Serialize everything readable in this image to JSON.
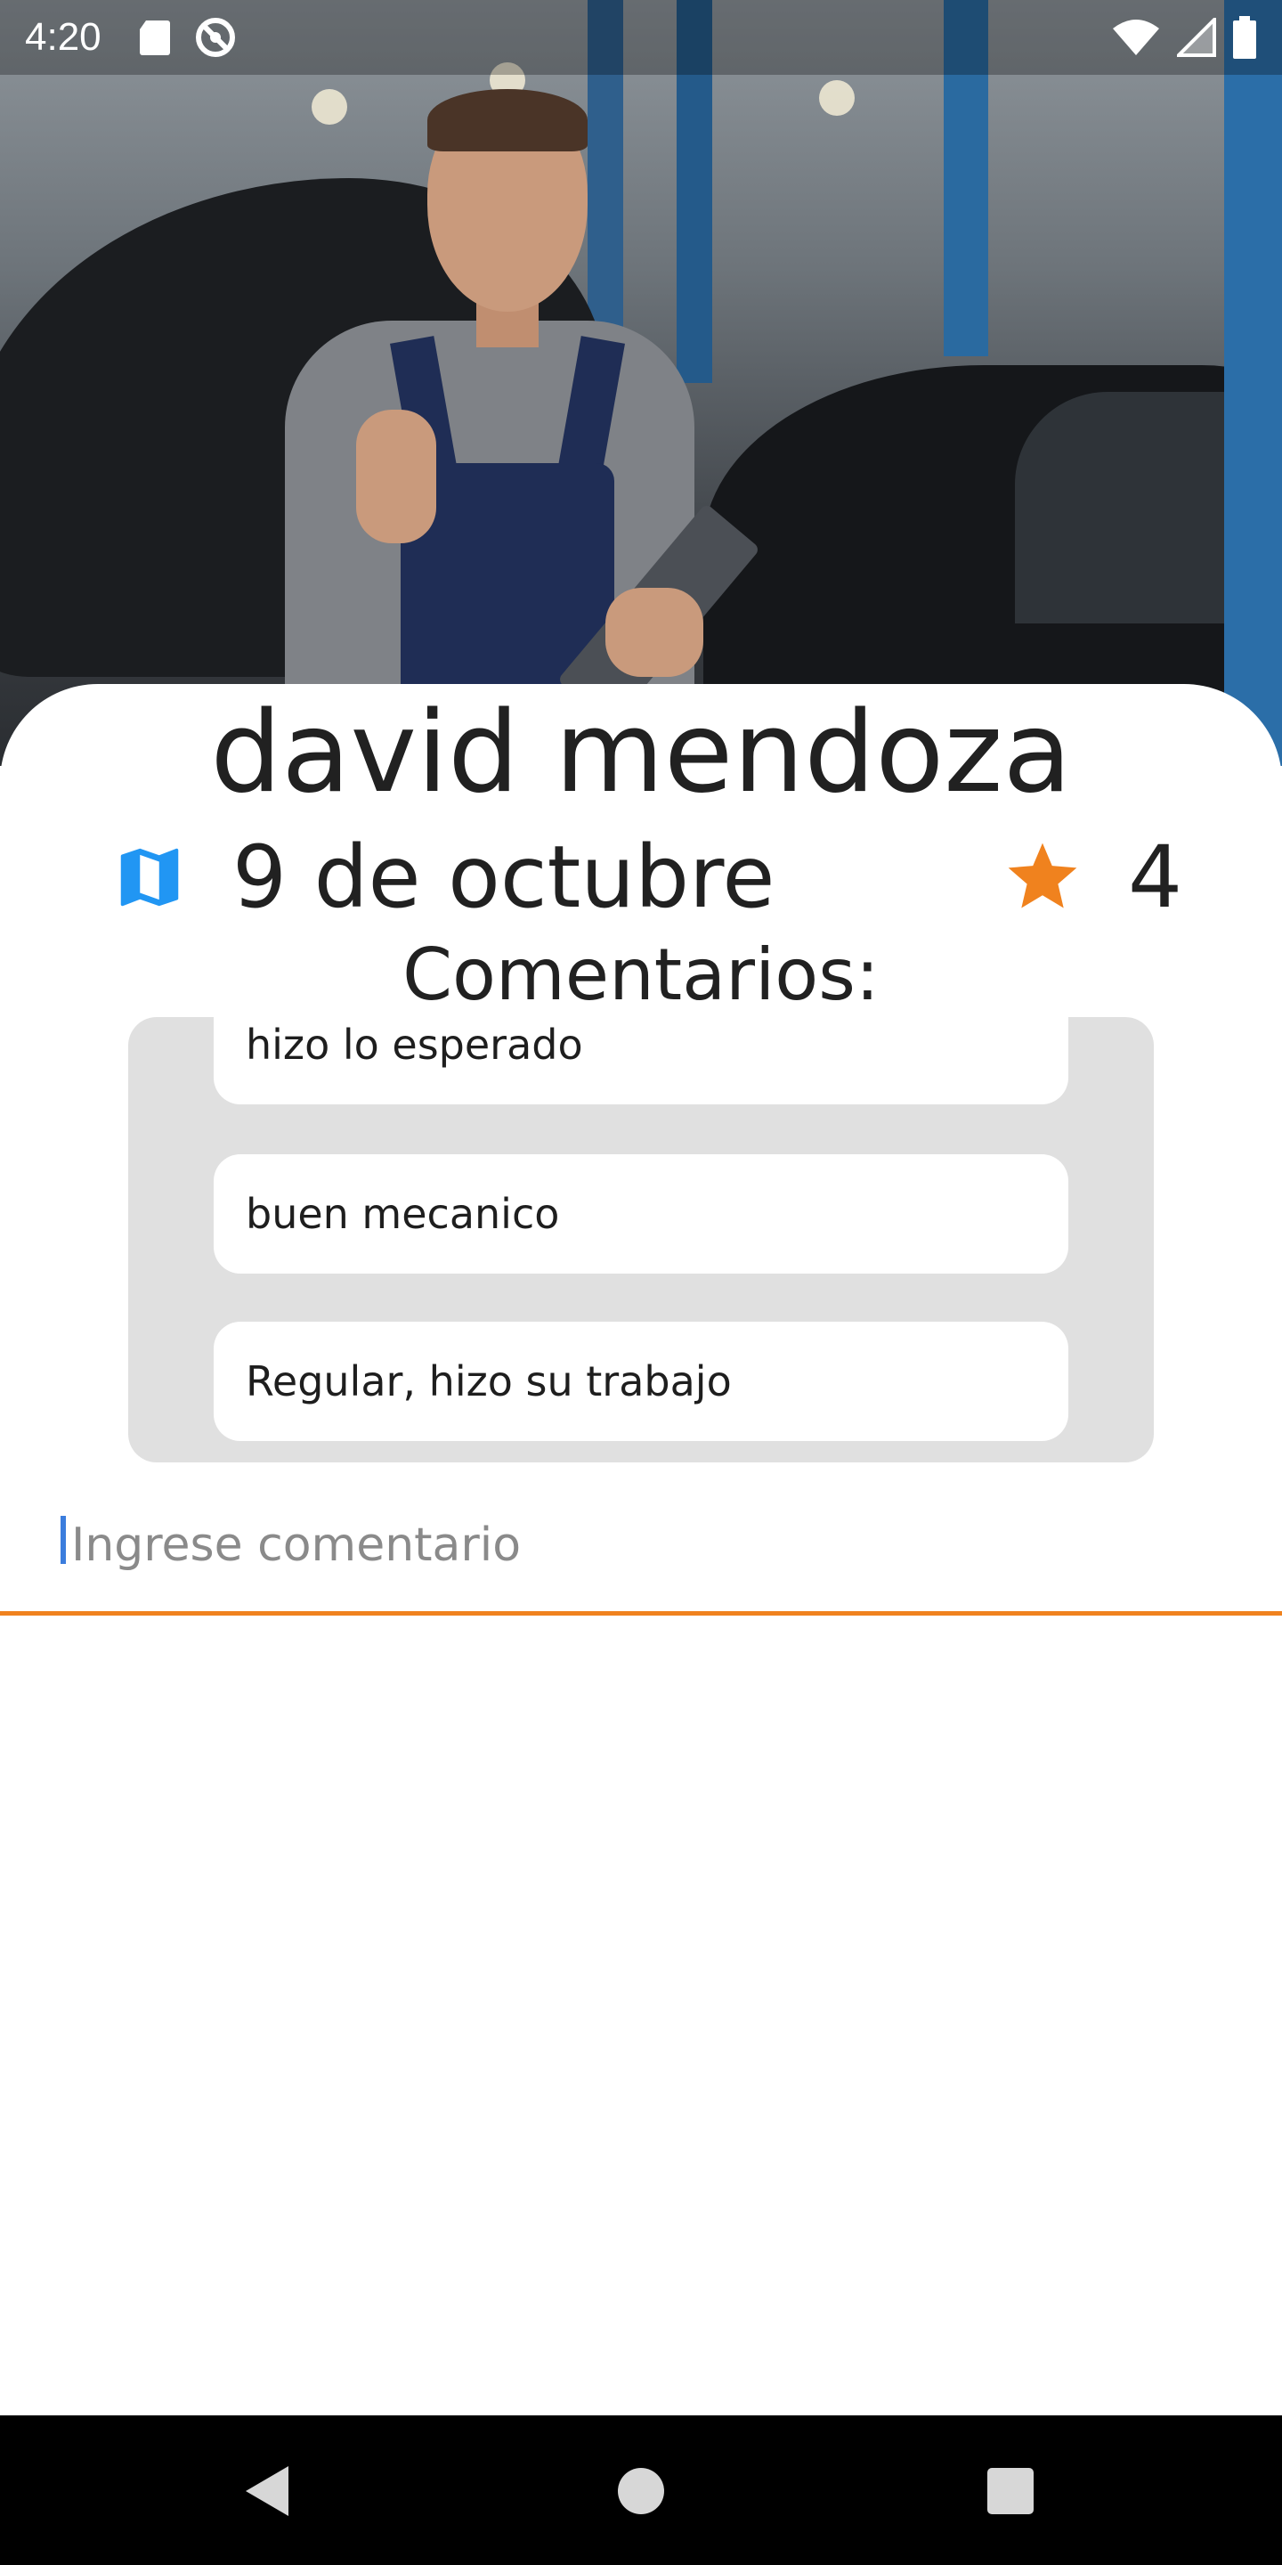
{
  "status_bar": {
    "time": "4:20",
    "left_icons": [
      "sd-card-icon",
      "no-disturb-icon"
    ],
    "right_icons": [
      "wifi-icon",
      "cell-signal-icon",
      "battery-icon"
    ]
  },
  "hero": {
    "image": "mechanic-photo"
  },
  "profile": {
    "name": "david mendoza",
    "date": "9 de octubre",
    "rating": "4",
    "date_icon": "map-icon",
    "rating_icon": "star-icon"
  },
  "comments": {
    "title": "Comentarios:",
    "items": [
      "hizo lo esperado",
      "buen mecanico",
      "Regular, hizo su trabajo"
    ]
  },
  "comment_input": {
    "placeholder": "Ingrese comentario",
    "value": ""
  },
  "nav_bar": {
    "buttons": [
      "back-icon",
      "home-icon",
      "recents-icon"
    ]
  },
  "colors": {
    "accent_orange": "#f0821e",
    "map_blue": "#2196f3",
    "star_orange": "#f0821e",
    "panel_gray": "#e0e0e0"
  }
}
